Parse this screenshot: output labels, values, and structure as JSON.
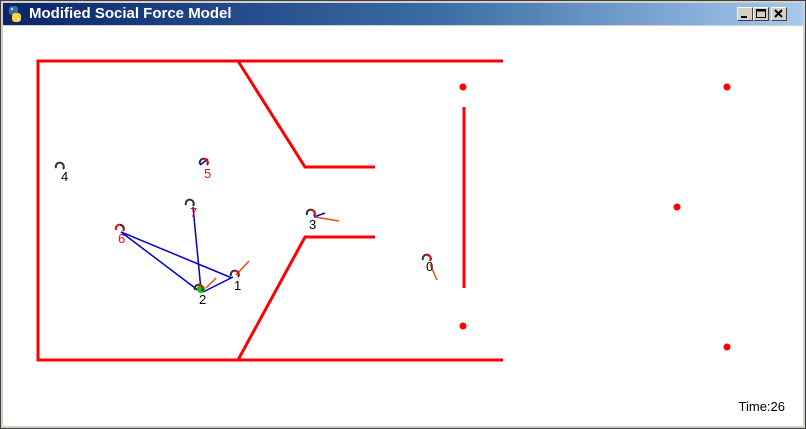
{
  "window": {
    "title": "Modified Social Force Model",
    "icon": "python-icon",
    "controls": [
      "minimize-icon",
      "maximize-icon",
      "close-icon"
    ]
  },
  "colors": {
    "wall": "#ff0000",
    "link": "#0000cc",
    "agent_dark": "#333333",
    "agent_red": "#ff0000",
    "highlight": "#00cc00",
    "velocity": "#e05010"
  },
  "agents": [
    {
      "id": "0",
      "label": "0",
      "label_color": "#000000"
    },
    {
      "id": "1",
      "label": "1",
      "label_color": "#000000"
    },
    {
      "id": "2",
      "label": "2",
      "label_color": "#000000"
    },
    {
      "id": "3",
      "label": "3",
      "label_color": "#000000"
    },
    {
      "id": "4",
      "label": "4",
      "label_color": "#000000"
    },
    {
      "id": "5",
      "label": "5",
      "label_color": "#ff0000"
    },
    {
      "id": "6",
      "label": "6",
      "label_color": "#ff0000"
    },
    {
      "id": "7",
      "label": "7",
      "label_color": "#ff0000"
    }
  ],
  "status": {
    "time_text": "Time:26"
  }
}
